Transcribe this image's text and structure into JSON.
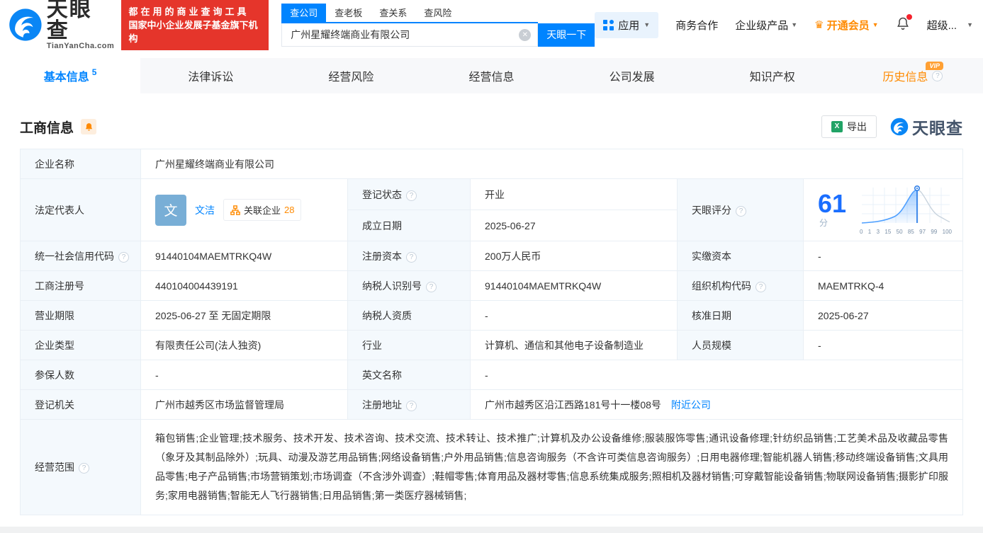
{
  "header": {
    "logo": {
      "text": "天眼查",
      "domain": "TianYanCha.com"
    },
    "slogan": {
      "line1": "都在用的商业查询工具",
      "line2": "国家中小企业发展子基金旗下机构"
    },
    "search": {
      "tabs": [
        {
          "label": "查公司"
        },
        {
          "label": "查老板"
        },
        {
          "label": "查关系"
        },
        {
          "label": "查风险"
        }
      ],
      "value": "广州星耀终端商业有限公司",
      "button": "天眼一下"
    },
    "nav": {
      "apps": "应用",
      "biz_coop": "商务合作",
      "enterprise": "企业级产品",
      "vip": "开通会员",
      "user": "超级..."
    }
  },
  "tabs": {
    "basic": {
      "label": "基本信息",
      "count": "5"
    },
    "legal": {
      "label": "法律诉讼"
    },
    "risk": {
      "label": "经营风险"
    },
    "operation": {
      "label": "经营信息"
    },
    "development": {
      "label": "公司发展"
    },
    "ip": {
      "label": "知识产权"
    },
    "history": {
      "label": "历史信息",
      "badge": "VIP"
    }
  },
  "section": {
    "title": "工商信息",
    "export": "导出",
    "brand": "天眼查"
  },
  "legal_rep": {
    "avatar": "文",
    "name": "文洁",
    "related_label": "关联企业",
    "related_count": "28"
  },
  "score": {
    "label": "天眼评分",
    "value": "61",
    "unit": "分",
    "ticks": [
      "0",
      "1",
      "3",
      "15",
      "50",
      "85",
      "97",
      "99",
      "100"
    ]
  },
  "fields": {
    "company_name": {
      "label": "企业名称",
      "value": "广州星耀终端商业有限公司"
    },
    "legal_rep": {
      "label": "法定代表人"
    },
    "reg_status": {
      "label": "登记状态",
      "value": "开业"
    },
    "establish_date": {
      "label": "成立日期",
      "value": "2025-06-27"
    },
    "credit_code": {
      "label": "统一社会信用代码",
      "value": "91440104MAEMTRKQ4W"
    },
    "reg_capital": {
      "label": "注册资本",
      "value": "200万人民币"
    },
    "paid_capital": {
      "label": "实缴资本",
      "value": "-"
    },
    "reg_number": {
      "label": "工商注册号",
      "value": "440104004439191"
    },
    "taxpayer_id": {
      "label": "纳税人识别号",
      "value": "91440104MAEMTRKQ4W"
    },
    "org_code": {
      "label": "组织机构代码",
      "value": "MAEMTRKQ-4"
    },
    "business_term": {
      "label": "营业期限",
      "value": "2025-06-27 至 无固定期限"
    },
    "taxpayer_quality": {
      "label": "纳税人资质",
      "value": "-"
    },
    "approval_date": {
      "label": "核准日期",
      "value": "2025-06-27"
    },
    "company_type": {
      "label": "企业类型",
      "value": "有限责任公司(法人独资)"
    },
    "industry": {
      "label": "行业",
      "value": "计算机、通信和其他电子设备制造业"
    },
    "staff_size": {
      "label": "人员规模",
      "value": "-"
    },
    "insured_count": {
      "label": "参保人数",
      "value": "-"
    },
    "english_name": {
      "label": "英文名称",
      "value": "-"
    },
    "reg_authority": {
      "label": "登记机关",
      "value": "广州市越秀区市场监督管理局"
    },
    "reg_address": {
      "label": "注册地址",
      "value": "广州市越秀区沿江西路181号十一楼08号",
      "link": "附近公司"
    },
    "business_scope": {
      "label": "经营范围",
      "value": "箱包销售;企业管理;技术服务、技术开发、技术咨询、技术交流、技术转让、技术推广;计算机及办公设备维修;服装服饰零售;通讯设备修理;针纺织品销售;工艺美术品及收藏品零售（象牙及其制品除外）;玩具、动漫及游艺用品销售;网络设备销售;户外用品销售;信息咨询服务（不含许可类信息咨询服务）;日用电器修理;智能机器人销售;移动终端设备销售;文具用品零售;电子产品销售;市场营销策划;市场调查（不含涉外调查）;鞋帽零售;体育用品及器材零售;信息系统集成服务;照相机及器材销售;可穿戴智能设备销售;物联网设备销售;摄影扩印服务;家用电器销售;智能无人飞行器销售;日用品销售;第一类医疗器械销售;"
    }
  },
  "colors": {
    "accent": "#0084ff",
    "vip_orange": "#ff8a00",
    "open_green": "#2db54d",
    "banner_red": "#e5352b"
  }
}
